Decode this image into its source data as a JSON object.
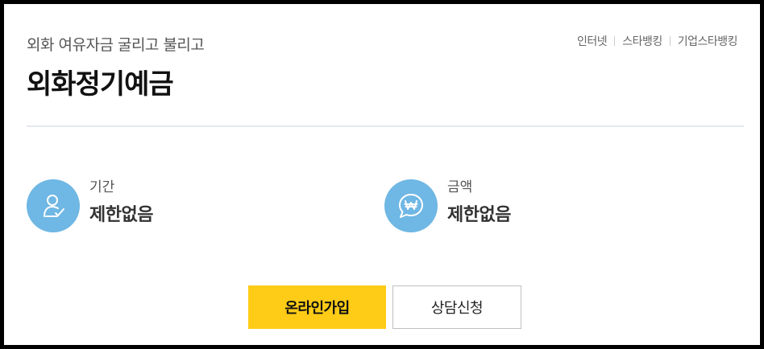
{
  "product": {
    "subtitle": "외화 여유자금 굴리고 불리고",
    "title": "외화정기예금"
  },
  "channels": [
    "인터넷",
    "스타뱅킹",
    "기업스타뱅킹"
  ],
  "info": {
    "period": {
      "label": "기간",
      "value": "제한없음",
      "icon": "person-check-icon"
    },
    "amount": {
      "label": "금액",
      "value": "제한없음",
      "icon": "won-speech-bubble-icon"
    }
  },
  "buttons": {
    "join_label": "온라인가입",
    "consult_label": "상담신청"
  },
  "colors": {
    "accent_yellow": "#fecc17",
    "icon_blue": "#6fb7e4",
    "frame_border": "#000000"
  }
}
